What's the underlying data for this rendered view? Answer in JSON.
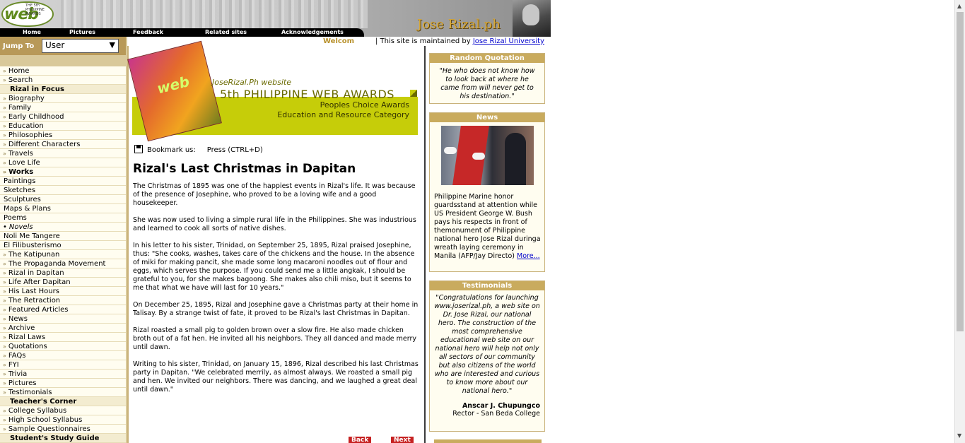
{
  "header": {
    "logo_text": "web",
    "logo_small": "THE 5th PHILIPPINE AWARDS",
    "site_title": "Jose Rizal.ph",
    "nav": [
      "Home",
      "Pictures",
      "Feedback",
      "Related sites",
      "Acknowledgements"
    ]
  },
  "jump": {
    "label": "Jump To",
    "selected": "User"
  },
  "sidebar": {
    "items": [
      {
        "label": "Home",
        "kind": "chev"
      },
      {
        "label": "Search",
        "kind": "chev"
      },
      {
        "label": "Rizal in Focus",
        "kind": "section"
      },
      {
        "label": "Biography",
        "kind": "chev"
      },
      {
        "label": "Family",
        "kind": "chev"
      },
      {
        "label": "Early Childhood",
        "kind": "chev"
      },
      {
        "label": "Education",
        "kind": "chev"
      },
      {
        "label": "Philosophies",
        "kind": "chev"
      },
      {
        "label": "Different Characters",
        "kind": "chev"
      },
      {
        "label": "Travels",
        "kind": "chev"
      },
      {
        "label": "Love Life",
        "kind": "chev"
      },
      {
        "label": "Works",
        "kind": "head2"
      },
      {
        "label": "Paintings",
        "kind": "plain"
      },
      {
        "label": "Sketches",
        "kind": "plain"
      },
      {
        "label": "Sculptures",
        "kind": "plain"
      },
      {
        "label": "Maps & Plans",
        "kind": "plain"
      },
      {
        "label": "Poems",
        "kind": "plain"
      },
      {
        "label": "Novels",
        "kind": "bullet"
      },
      {
        "label": "Noli Me Tangere",
        "kind": "plain"
      },
      {
        "label": "El Filibusterismo",
        "kind": "plain"
      },
      {
        "label": "The Katipunan",
        "kind": "chev"
      },
      {
        "label": "The Propaganda Movement",
        "kind": "chev"
      },
      {
        "label": "Rizal in Dapitan",
        "kind": "chev"
      },
      {
        "label": "Life After Dapitan",
        "kind": "chev"
      },
      {
        "label": "His Last Hours",
        "kind": "chev"
      },
      {
        "label": "The Retraction",
        "kind": "chev"
      },
      {
        "label": "Featured Articles",
        "kind": "chev"
      },
      {
        "label": "News",
        "kind": "chev"
      },
      {
        "label": "Archive",
        "kind": "chev"
      },
      {
        "label": "Rizal Laws",
        "kind": "chev"
      },
      {
        "label": "Quotations",
        "kind": "chev"
      },
      {
        "label": "FAQs",
        "kind": "chev"
      },
      {
        "label": "FYI",
        "kind": "chev"
      },
      {
        "label": "Trivia",
        "kind": "chev"
      },
      {
        "label": "Pictures",
        "kind": "chev"
      },
      {
        "label": "Testimonials",
        "kind": "chev"
      },
      {
        "label": "Teacher's Corner",
        "kind": "section"
      },
      {
        "label": "College Syllabus",
        "kind": "chev"
      },
      {
        "label": "High School Syllabus",
        "kind": "chev"
      },
      {
        "label": "Sample Questionnaires",
        "kind": "chev"
      },
      {
        "label": "Student's Study Guide",
        "kind": "section"
      }
    ]
  },
  "strip": {
    "welcome": "Welcom",
    "maintained_prefix": "| This site is maintained by",
    "maintained_link": "Jose Rizal University"
  },
  "banner": {
    "book_text": "web",
    "line1": "JoseRizal.Ph website",
    "line2": "5th PHILIPPINE WEB AWARDS",
    "line3": "Peoples Choice Awards",
    "line4": "Education and Resource Category"
  },
  "bookmark": {
    "label": "Bookmark us:",
    "hint": "Press (CTRL+D)"
  },
  "article": {
    "title": "Rizal's Last Christmas in Dapitan",
    "paragraphs": [
      "The Christmas of 1895 was one of the happiest events in Rizal's life. It was because of the presence of Josephine, who proved to be a loving wife and a good housekeeper.",
      "She was now used to living a simple rural life in the Philippines. She was industrious and learned to cook all sorts of native dishes.",
      "In his letter to his sister, Trinidad, on September 25, 1895, Rizal praised Josephine, thus: \"She cooks, washes, takes care of the chickens and the house. In the absence of miki for making pancit, she made some long macaroni noodles out of flour and eggs, which serves the purpose. If you could send me a little angkak, I should be grateful to you, for she makes bagoong. She makes also chili miso, but it seems to me that what we have will last for 10 years.\"",
      "On December 25, 1895, Rizal and Josephine gave a Christmas party at their home in Talisay. By a strange twist of fate, it proved to be Rizal's last Christmas in Dapitan.",
      "Rizal roasted a small pig to golden brown over a slow fire. He also made chicken broth out of a fat hen. He invited all his neighbors. They all danced and made merry until dawn.",
      "Writing to his sister, Trinidad, on January 15, 1896, Rizal described his last Christmas party in Dapitan. \"We celebrated merrily, as almost always. We roasted a small pig and hen. We invited our neighbors. There was dancing, and we laughed a great deal until dawn.\""
    ],
    "back_label": "Back",
    "next_label": "Next"
  },
  "quotation": {
    "heading": "Random Quotation",
    "text": "\"He who does not know how to look back at where he came from will never get to his destination.\""
  },
  "news": {
    "heading": "News",
    "text": "Philippine Marine honor guardsstand at attention while US President George W. Bush pays his respects in front of themonument of Philippine national hero Jose Rizal duringa wreath laying ceremony in Manila (AFP/Jay Directo)",
    "more": "More..."
  },
  "testimonials": {
    "heading": "Testimonials",
    "text": "\"Congratulations for launching www.joserizal.ph, a web site on Dr. Jose Rizal, our national hero. The construction of the most comprehensive educational web site on our national hero will help not only all sectors of our community but also citizens of the world who are interested and curious to know more about our national hero.\"",
    "author": "Anscar J. Chupungco",
    "role": "Rector - San Beda College"
  }
}
